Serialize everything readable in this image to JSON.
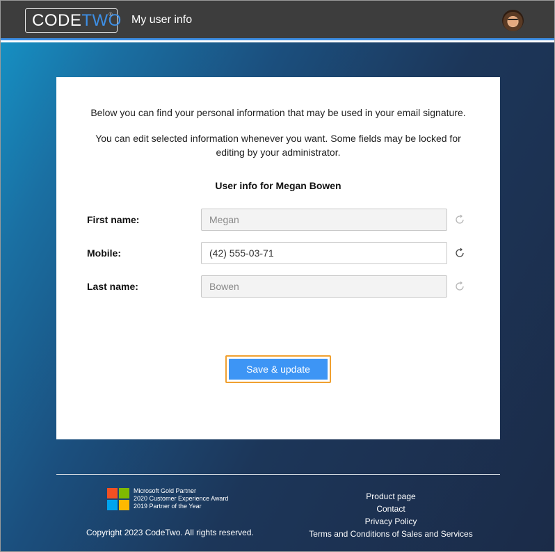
{
  "header": {
    "logo_code": "CODE",
    "logo_two": "TWO",
    "logo_reg": "®",
    "title": "My user info",
    "accent": "#3d8fe6",
    "avatar_icon": "user-avatar-photo"
  },
  "card": {
    "intro_1": "Below you can find your personal information that may be used in your email signature.",
    "intro_2": "You can edit selected information whenever you want. Some fields may be locked for editing by your administrator.",
    "user_heading": "User info for Megan Bowen",
    "fields": [
      {
        "label": "First name:",
        "value": "Megan",
        "locked": true
      },
      {
        "label": "Mobile:",
        "value": "(42) 555-03-71",
        "locked": false
      },
      {
        "label": "Last name:",
        "value": "Bowen",
        "locked": true
      }
    ],
    "reset_icon": "refresh-icon",
    "save_label": "Save & update",
    "save_color": "#3d95f5",
    "focus_color": "#f0a030"
  },
  "footer": {
    "partner_1": "Microsoft Gold Partner",
    "partner_2": "2020 Customer Experience Award",
    "partner_3": "2019 Partner of the Year",
    "copyright": "Copyright 2023 CodeTwo. All rights reserved.",
    "links": [
      "Product page",
      "Contact",
      "Privacy Policy",
      "Terms and Conditions of Sales and Services"
    ]
  }
}
